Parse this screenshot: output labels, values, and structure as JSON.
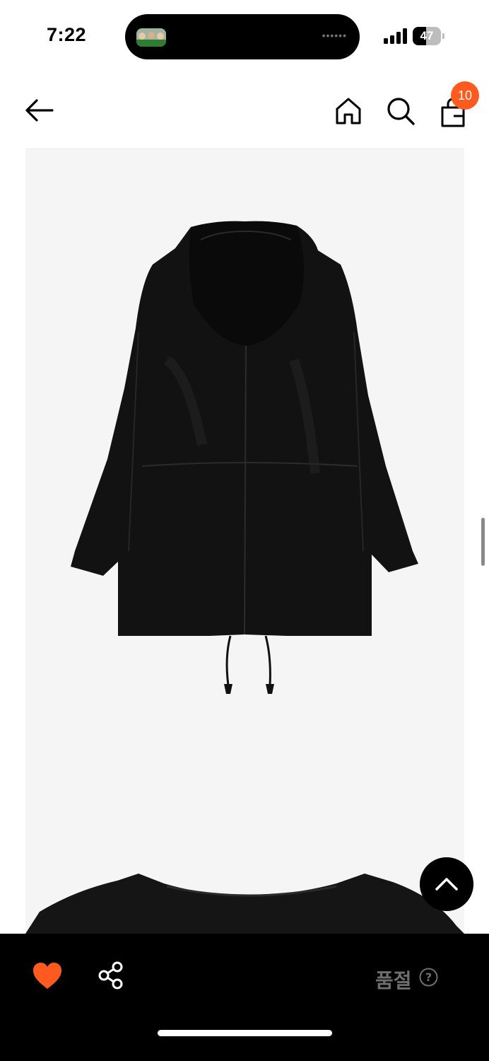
{
  "status_bar": {
    "time": "7:22",
    "battery_level": "47",
    "battery_fraction": 0.47,
    "signal_bars": 4
  },
  "header": {
    "back_icon": "arrow-left-icon",
    "home_icon": "home-icon",
    "search_icon": "search-icon",
    "bag_icon": "shopping-bag-icon",
    "cart_count": "10"
  },
  "product": {
    "image_description_icon": "black-hooded-jacket-back-view",
    "background_color": "#f5f5f5"
  },
  "bottom_bar": {
    "like_icon": "heart-icon",
    "share_icon": "share-icon",
    "status_label": "품절",
    "help_icon": "question-circle-icon",
    "scroll_top_icon": "chevron-up-icon"
  },
  "colors": {
    "accent": "#ff5a1f",
    "badge": "#ff5a1f",
    "bar": "#000000"
  }
}
